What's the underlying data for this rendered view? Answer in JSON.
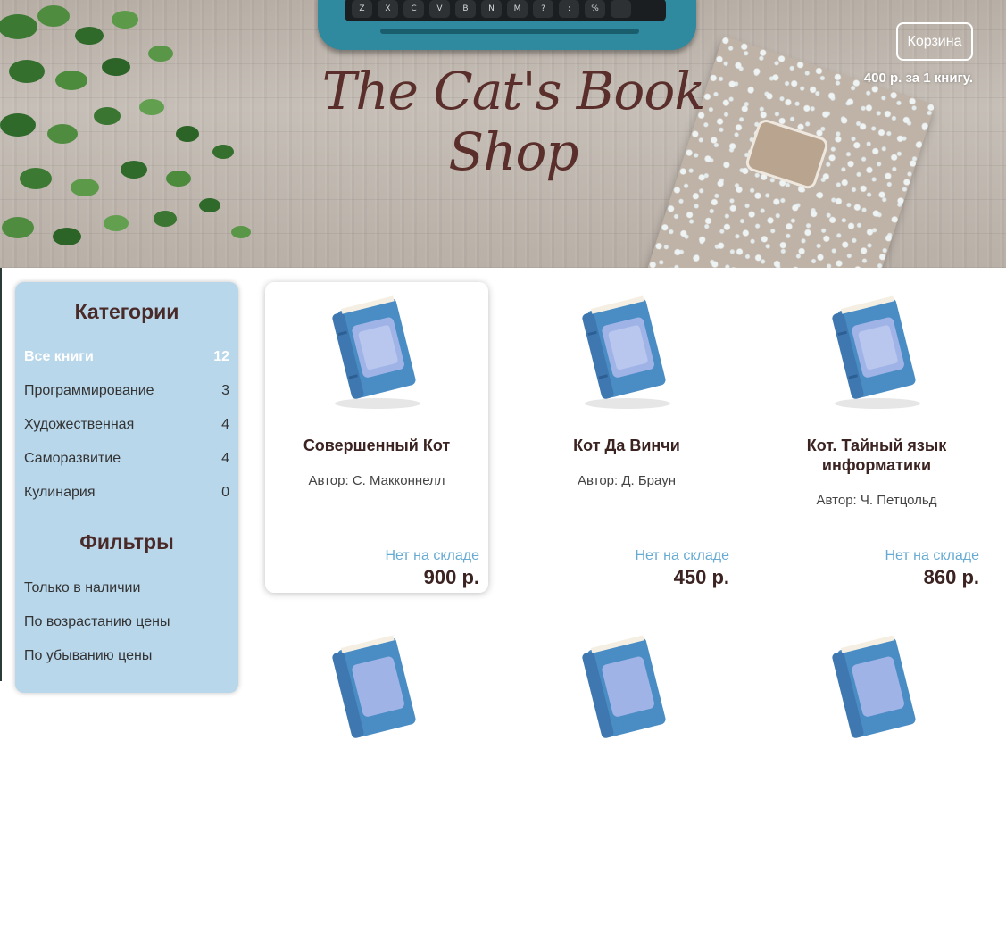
{
  "header": {
    "title": "The Cat's Book Shop",
    "cart_button": "Корзина",
    "cart_summary": "400 р. за 1 книгу."
  },
  "sidebar": {
    "categories_title": "Категории",
    "categories": [
      {
        "label": "Все книги",
        "count": "12",
        "active": true
      },
      {
        "label": "Программирование",
        "count": "3"
      },
      {
        "label": "Художественная",
        "count": "4"
      },
      {
        "label": "Саморазвитие",
        "count": "4"
      },
      {
        "label": "Кулинария",
        "count": "0"
      }
    ],
    "filters_title": "Фильтры",
    "filters": [
      {
        "label": "Только в наличии"
      },
      {
        "label": "По возрастанию цены"
      },
      {
        "label": "По убыванию цены"
      }
    ]
  },
  "products": [
    {
      "title": "Совершенный Кот",
      "author": "Автор: С. Макконнелл",
      "stock": "Нет на складе",
      "price": "900 р."
    },
    {
      "title": "Кот Да Винчи",
      "author": "Автор: Д. Браун",
      "stock": "Нет на складе",
      "price": "450 р."
    },
    {
      "title": "Кот. Тайный язык информатики",
      "author": "Автор: Ч. Петцольд",
      "stock": "Нет на складе",
      "price": "860 р."
    }
  ],
  "icons": {
    "book_cover": "book-icon",
    "header_decor": [
      "plant-icon",
      "typewriter-icon",
      "notebook-icon"
    ]
  },
  "colors": {
    "sidebar_bg": "#b8d7eb",
    "title_color": "#5a2f2b",
    "stock_color": "#67abd3",
    "price_color": "#3b2321"
  }
}
